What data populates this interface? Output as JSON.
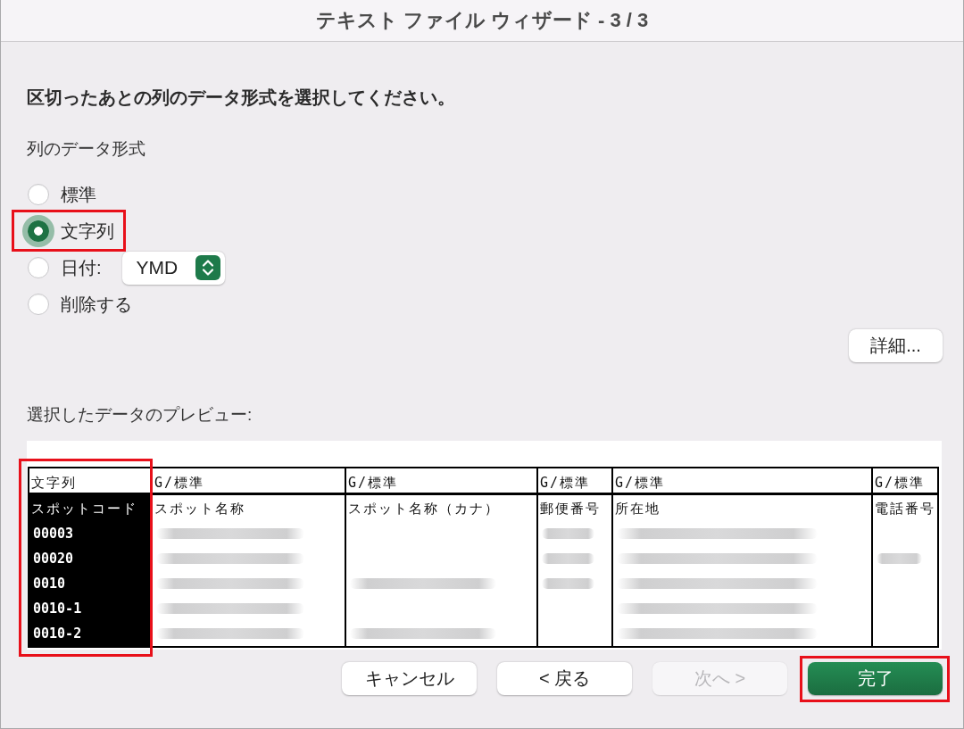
{
  "window": {
    "title": "テキスト ファイル ウィザード - 3 / 3"
  },
  "instruction": "区切ったあとの列のデータ形式を選択してください。",
  "column_format": {
    "label": "列のデータ形式",
    "options": [
      {
        "label": "標準",
        "selected": false,
        "highlighted": false
      },
      {
        "label": "文字列",
        "selected": true,
        "highlighted": true
      },
      {
        "label": "日付:",
        "selected": false,
        "highlighted": false,
        "dropdown": {
          "value": "YMD"
        }
      },
      {
        "label": "削除する",
        "selected": false,
        "highlighted": false
      }
    ]
  },
  "details_button": "詳細...",
  "preview": {
    "label": "選択したデータのプレビュー:",
    "columns": [
      {
        "format": "文字列",
        "name": "スポットコード",
        "selected": true,
        "highlighted": true
      },
      {
        "format": "G/標準",
        "name": "スポット名称",
        "selected": false,
        "highlighted": false
      },
      {
        "format": "G/標準",
        "name": "スポット名称（カナ）",
        "selected": false,
        "highlighted": false
      },
      {
        "format": "G/標準",
        "name": "郵便番号",
        "selected": false,
        "highlighted": false
      },
      {
        "format": "G/標準",
        "name": "所在地",
        "selected": false,
        "highlighted": false
      },
      {
        "format": "G/標準",
        "name": "電話番号",
        "selected": false,
        "highlighted": false
      }
    ],
    "rows": [
      {
        "cells": [
          {
            "kind": "text",
            "text": "00003"
          },
          {
            "kind": "blurred"
          },
          {
            "kind": "blank"
          },
          {
            "kind": "blurred"
          },
          {
            "kind": "blurred"
          },
          {
            "kind": "blank"
          }
        ]
      },
      {
        "cells": [
          {
            "kind": "text",
            "text": "00020"
          },
          {
            "kind": "blurred"
          },
          {
            "kind": "blank"
          },
          {
            "kind": "blurred"
          },
          {
            "kind": "blurred"
          },
          {
            "kind": "blurred"
          }
        ]
      },
      {
        "cells": [
          {
            "kind": "text",
            "text": "0010"
          },
          {
            "kind": "blurred"
          },
          {
            "kind": "blurred"
          },
          {
            "kind": "blurred"
          },
          {
            "kind": "blurred"
          },
          {
            "kind": "blank"
          }
        ]
      },
      {
        "cells": [
          {
            "kind": "text",
            "text": "0010-1"
          },
          {
            "kind": "blurred"
          },
          {
            "kind": "blank"
          },
          {
            "kind": "blank"
          },
          {
            "kind": "blurred"
          },
          {
            "kind": "blank"
          }
        ]
      },
      {
        "cells": [
          {
            "kind": "text",
            "text": "0010-2"
          },
          {
            "kind": "blurred"
          },
          {
            "kind": "blurred"
          },
          {
            "kind": "blank"
          },
          {
            "kind": "blurred"
          },
          {
            "kind": "blank"
          }
        ]
      }
    ]
  },
  "buttons": [
    {
      "label": "キャンセル",
      "kind": "secondary",
      "disabled": false,
      "highlighted": false
    },
    {
      "label": "< 戻る",
      "kind": "secondary",
      "disabled": false,
      "highlighted": false
    },
    {
      "label": "次へ >",
      "kind": "secondary",
      "disabled": true,
      "highlighted": false
    },
    {
      "label": "完了",
      "kind": "primary",
      "disabled": false,
      "highlighted": true
    }
  ]
}
